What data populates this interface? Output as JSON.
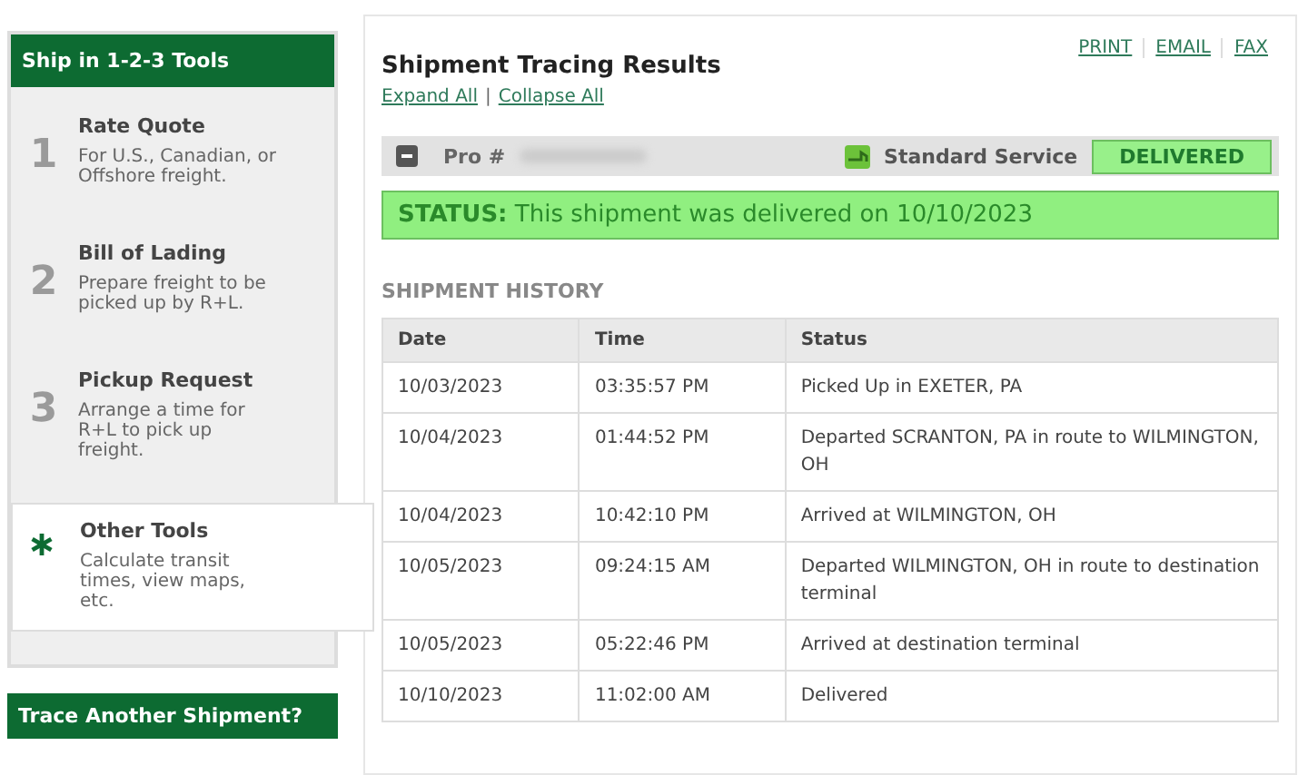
{
  "sidebar": {
    "title": "Ship in 1-2-3 Tools",
    "tools": [
      {
        "kind": "number",
        "marker": "1",
        "title": "Rate Quote",
        "description": "For U.S., Canadian, or Offshore freight.",
        "selected": false
      },
      {
        "kind": "number",
        "marker": "2",
        "title": "Bill of Lading",
        "description": "Prepare freight to be picked up by R+L.",
        "selected": false
      },
      {
        "kind": "number",
        "marker": "3",
        "title": "Pickup Request",
        "description": "Arrange a time for R+L to pick up freight.",
        "selected": false
      },
      {
        "kind": "star",
        "title": "Other Tools",
        "description": "Calculate transit times, view maps, etc.",
        "selected": true
      }
    ],
    "button": "Trace Another Shipment?"
  },
  "results": {
    "title": "Shipment Tracing Results",
    "actions": [
      "PRINT",
      "EMAIL",
      "FAX"
    ],
    "expand": "Expand All",
    "separator": "|",
    "collapse": "Collapse All",
    "shipment": {
      "pro_label": "Pro #",
      "expanded": true,
      "service": "Standard Service",
      "badge": "DELIVERED",
      "status_label": "STATUS:",
      "status_text": "This shipment was delivered on 10/10/2023"
    },
    "history": {
      "title": "SHIPMENT HISTORY",
      "columns": [
        "Date",
        "Time",
        "Status"
      ],
      "rows": [
        [
          "10/03/2023",
          "03:35:57 PM",
          "Picked Up in EXETER, PA"
        ],
        [
          "10/04/2023",
          "01:44:52 PM",
          "Departed SCRANTON, PA in route to WILMINGTON, OH"
        ],
        [
          "10/04/2023",
          "10:42:10 PM",
          "Arrived at WILMINGTON, OH"
        ],
        [
          "10/05/2023",
          "09:24:15 AM",
          "Departed WILMINGTON, OH in route to destination terminal"
        ],
        [
          "10/05/2023",
          "05:22:46 PM",
          "Arrived at destination terminal"
        ],
        [
          "10/10/2023",
          "11:02:00 AM",
          "Delivered"
        ]
      ]
    }
  }
}
